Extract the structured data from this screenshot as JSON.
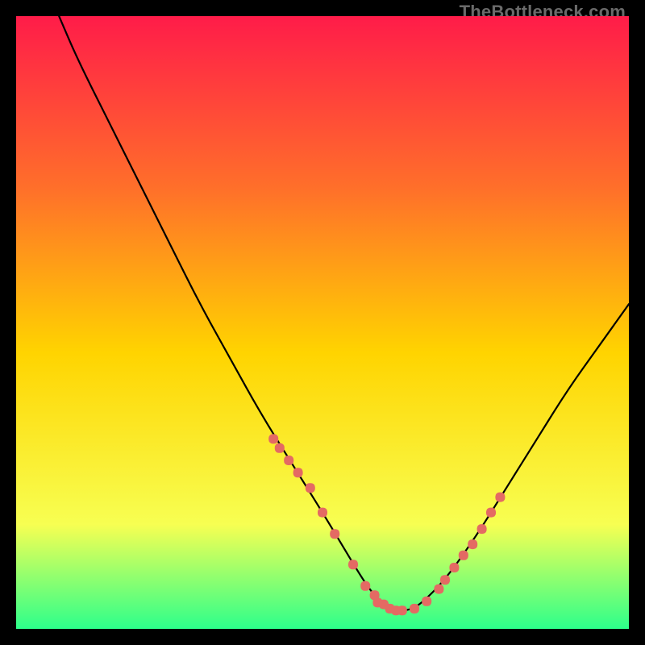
{
  "watermark": "TheBottleneck.com",
  "chart_data": {
    "type": "line",
    "title": "",
    "xlabel": "",
    "ylabel": "",
    "xlim": [
      0,
      100
    ],
    "ylim": [
      0,
      100
    ],
    "background_gradient": {
      "top": "#ff1c49",
      "mid_upper": "#ff6f2a",
      "mid": "#ffd400",
      "lower": "#f7ff52",
      "bottom": "#2dff8b"
    },
    "series": [
      {
        "name": "bottleneck-curve",
        "color": "#000000",
        "x": [
          7,
          10,
          15,
          20,
          25,
          30,
          35,
          40,
          45,
          50,
          53,
          56,
          58,
          60,
          62,
          64,
          66,
          70,
          75,
          80,
          85,
          90,
          95,
          100
        ],
        "y": [
          100,
          93,
          83,
          73,
          63,
          53,
          44,
          35,
          27,
          19,
          14,
          9,
          6,
          4,
          3,
          3,
          4,
          8,
          15,
          23,
          31,
          39,
          46,
          53
        ]
      },
      {
        "name": "highlight-dots-left",
        "color": "#e46a63",
        "type": "scatter",
        "x": [
          42,
          43,
          44.5,
          46,
          48,
          50,
          52,
          55,
          57,
          58.5,
          60,
          62
        ],
        "y": [
          31,
          29.5,
          27.5,
          25.5,
          23,
          19,
          15.5,
          10.5,
          7,
          5.5,
          4,
          3
        ],
        "marker": "rounded"
      },
      {
        "name": "highlight-dots-bottom",
        "color": "#e46a63",
        "type": "scatter",
        "x": [
          59,
          61,
          63,
          65,
          67,
          69
        ],
        "y": [
          4.3,
          3.3,
          3,
          3.3,
          4.5,
          6.5
        ],
        "marker": "rounded"
      },
      {
        "name": "highlight-dots-right",
        "color": "#e46a63",
        "type": "scatter",
        "x": [
          70,
          71.5,
          73,
          74.5,
          76,
          77.5,
          79
        ],
        "y": [
          8,
          10,
          12,
          13.8,
          16.3,
          19,
          21.5
        ],
        "marker": "rounded"
      }
    ]
  }
}
